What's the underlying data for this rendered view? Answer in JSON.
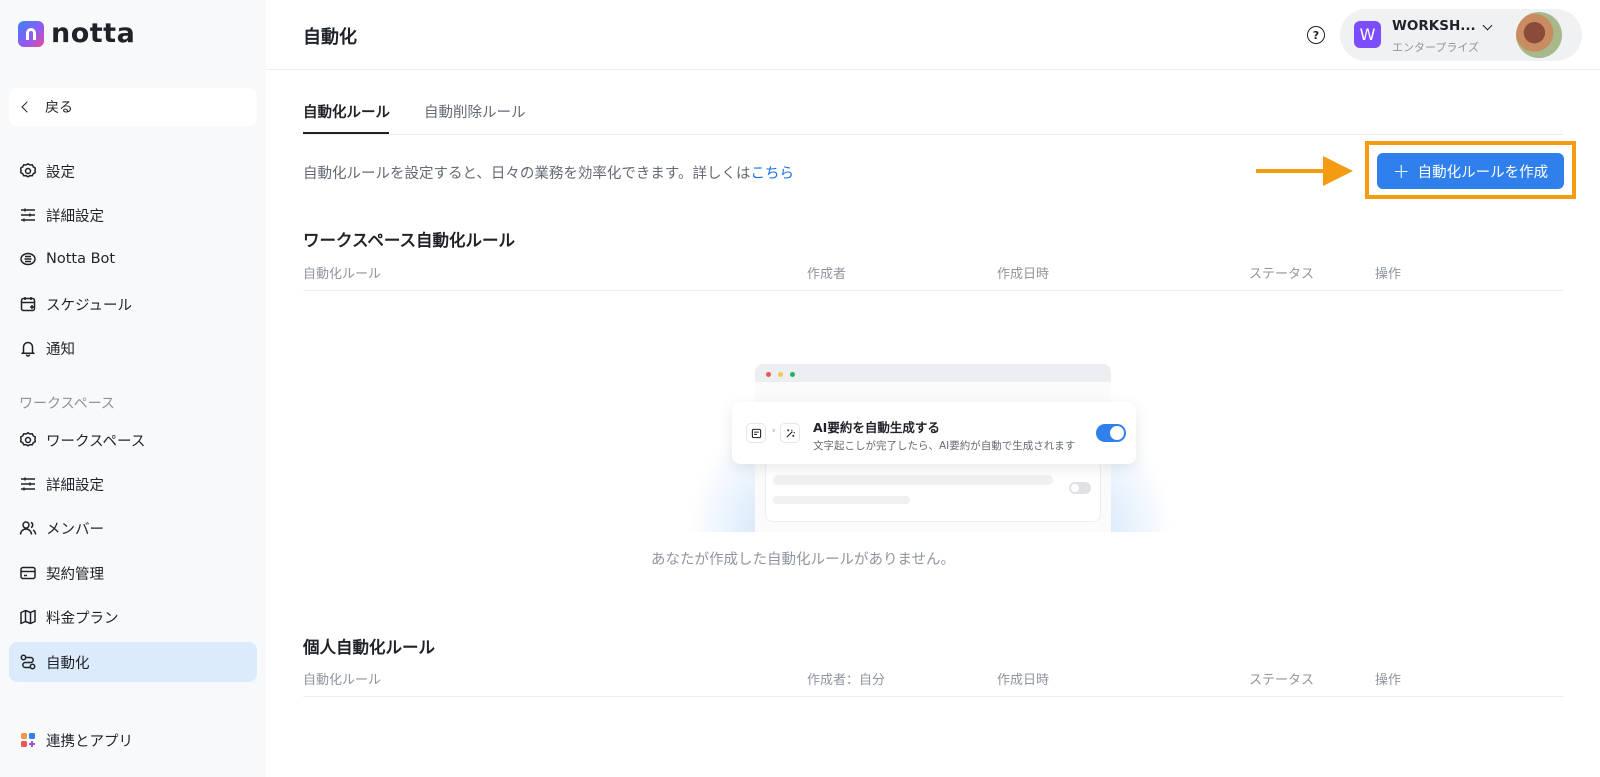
{
  "brand": {
    "name": "notta"
  },
  "sidebar": {
    "back_label": "戻る",
    "items": [
      {
        "label": "設定"
      },
      {
        "label": "詳細設定"
      },
      {
        "label": "Notta Bot"
      },
      {
        "label": "スケジュール"
      },
      {
        "label": "通知"
      }
    ],
    "workspace_section_label": "ワークスペース",
    "workspace_items": [
      {
        "label": "ワークスペース"
      },
      {
        "label": "詳細設定"
      },
      {
        "label": "メンバー"
      },
      {
        "label": "契約管理"
      },
      {
        "label": "料金プラン"
      },
      {
        "label": "自動化"
      }
    ],
    "integrations_label": "連携とアプリ"
  },
  "header": {
    "title": "自動化",
    "help_glyph": "?",
    "workspace_badge": "W",
    "workspace_name": "WORKSH...",
    "workspace_plan": "エンタープライズ"
  },
  "tabs": [
    {
      "label": "自動化ルール",
      "active": true
    },
    {
      "label": "自動削除ルール",
      "active": false
    }
  ],
  "description": {
    "text": "自動化ルールを設定すると、日々の業務を効率化できます。詳しくは",
    "link": "こちら"
  },
  "create_button": {
    "icon": "+",
    "label": "自動化ルールを作成"
  },
  "workspace_rules": {
    "title": "ワークスペース自動化ルール",
    "columns": [
      "自動化ルール",
      "作成者",
      "作成日時",
      "ステータス",
      "操作"
    ]
  },
  "empty_state": {
    "card_title": "AI要約を自動生成する",
    "card_subtitle": "文字起こしが完了したら、AI要約が自動で生成されます",
    "toggle_on": true,
    "message": "あなたが作成した自動化ルールがありません。"
  },
  "personal_rules": {
    "title": "個人自動化ルール",
    "columns": [
      "自動化ルール",
      "作成者：自分",
      "作成日時",
      "ステータス",
      "操作"
    ]
  },
  "colors": {
    "accent": "#2f80ed",
    "active_nav_bg": "#dcebfb",
    "annotation": "#f39c12",
    "sidebar_bg": "#f8f9fa"
  }
}
